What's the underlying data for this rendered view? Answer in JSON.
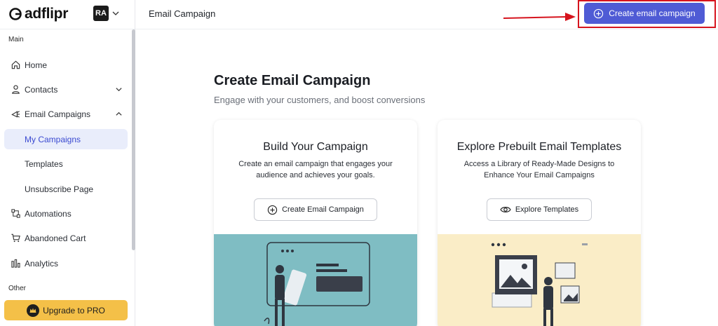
{
  "brand": {
    "name": "adflipr",
    "workspace_initials": "RA"
  },
  "sidebar": {
    "section_main": "Main",
    "section_other": "Other",
    "items": [
      {
        "label": "Home",
        "icon": "home-icon"
      },
      {
        "label": "Contacts",
        "icon": "user-icon"
      },
      {
        "label": "Email Campaigns",
        "icon": "megaphone-icon"
      },
      {
        "label": "My Campaigns"
      },
      {
        "label": "Templates"
      },
      {
        "label": "Unsubscribe Page"
      },
      {
        "label": "Automations",
        "icon": "flow-icon"
      },
      {
        "label": "Abandoned Cart",
        "icon": "cart-icon"
      },
      {
        "label": "Analytics",
        "icon": "bar-chart-icon"
      }
    ],
    "upgrade_label": "Upgrade to PRO"
  },
  "header": {
    "title": "Email Campaign",
    "create_button": "Create email campaign"
  },
  "main": {
    "title": "Create Email Campaign",
    "subtitle": "Engage with your customers, and boost conversions",
    "cards": [
      {
        "title": "Build Your Campaign",
        "description": "Create an email campaign that engages your audience and achieves your goals.",
        "button": "Create Email Campaign"
      },
      {
        "title": "Explore Prebuilt Email Templates",
        "description": "Access a Library of Ready-Made Designs to Enhance Your Email Campaigns",
        "button": "Explore Templates"
      }
    ]
  },
  "colors": {
    "accent": "#4f5bd5",
    "highlight": "#d6141e",
    "upgrade": "#f4c048",
    "active_nav_bg": "#e9edfb",
    "card1_illustration_bg": "#7fbdc3",
    "card2_illustration_bg": "#faedc7"
  }
}
